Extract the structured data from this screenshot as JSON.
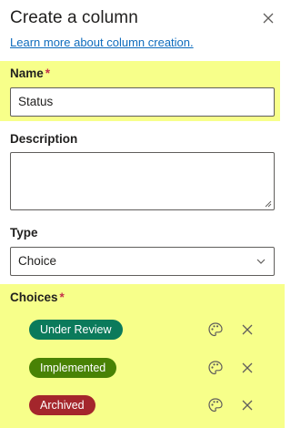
{
  "header": {
    "title": "Create a column"
  },
  "link": {
    "learn_more": "Learn more about column creation."
  },
  "fields": {
    "name": {
      "label": "Name",
      "required": "*",
      "value": "Status"
    },
    "description": {
      "label": "Description",
      "value": ""
    },
    "type": {
      "label": "Type",
      "value": "Choice"
    },
    "choices": {
      "label": "Choices",
      "required": "*",
      "items": [
        {
          "label": "Under Review",
          "color": "#0b7a5b"
        },
        {
          "label": "Implemented",
          "color": "#498205"
        },
        {
          "label": "Archived",
          "color": "#a4262c"
        }
      ]
    }
  },
  "icons": {
    "close": "close-icon",
    "dropdown": "chevron-down-icon",
    "palette": "palette-icon",
    "remove": "close-icon"
  },
  "colors": {
    "highlight": "#f7ff8a",
    "link": "#0f6cbd",
    "required": "#c4314b"
  }
}
